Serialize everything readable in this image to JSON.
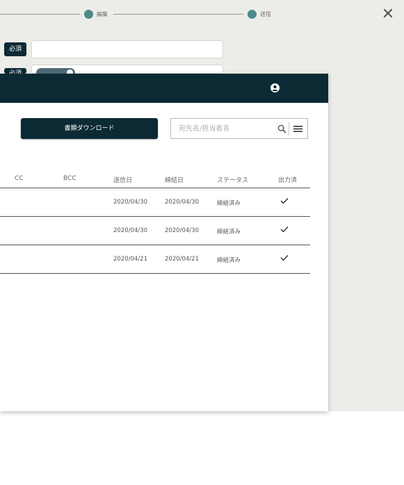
{
  "wizard": {
    "steps": [
      {
        "label": "編集"
      },
      {
        "label": "送信"
      }
    ],
    "required_badge": "必須",
    "required_badge_partial": "必須"
  },
  "toolbar": {
    "download_label": "書類ダウンロード",
    "search_placeholder": "宛先名/担当者名"
  },
  "table": {
    "headers": {
      "cc": "CC",
      "bcc": "BCC",
      "sent_date": "送信日",
      "signed_date": "締結日",
      "status": "ステータス",
      "output": "出力済"
    },
    "rows": [
      {
        "sent_date": "2020/04/30",
        "signed_date": "2020/04/30",
        "status": "締結済み",
        "output": true
      },
      {
        "sent_date": "2020/04/30",
        "signed_date": "2020/04/30",
        "status": "締結済み",
        "output": true
      },
      {
        "sent_date": "2020/04/21",
        "signed_date": "2020/04/21",
        "status": "締結済み",
        "output": true
      }
    ]
  },
  "icons": {
    "close": "close-icon",
    "user": "user-circle-icon",
    "search": "search-icon",
    "menu": "menu-icon",
    "check": "check-icon"
  },
  "colors": {
    "header_dark": "#0b2a33",
    "step_accent": "#4f8a8b",
    "background": "#ecede8"
  }
}
